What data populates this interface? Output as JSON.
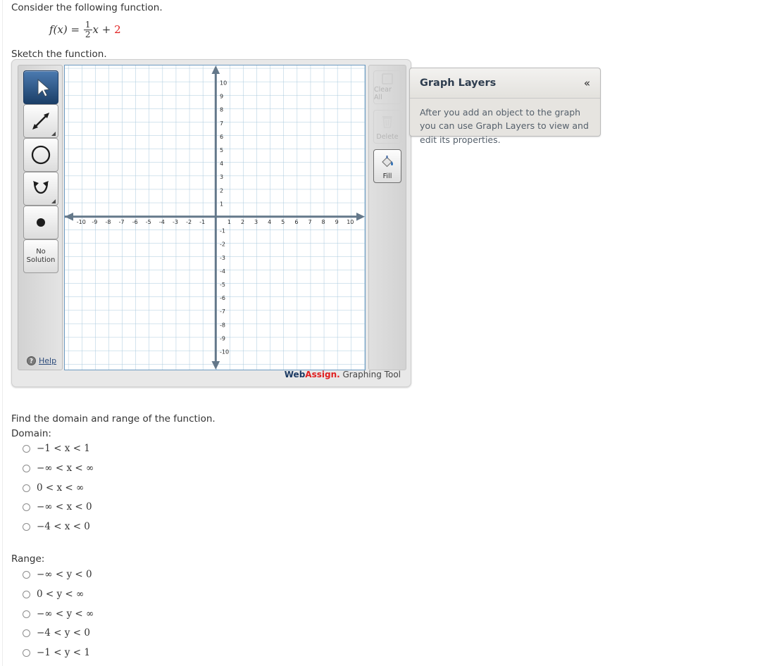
{
  "prompt": {
    "line1": "Consider the following function.",
    "formula": {
      "fname": "f(x)",
      "eq": "=",
      "num": "1",
      "den": "2",
      "var": "x",
      "plus": "+",
      "constant": "2"
    },
    "line2": "Sketch the function."
  },
  "graph_tool": {
    "left_toolbar": [
      {
        "name": "select-tool",
        "label": "Select",
        "selected": true
      },
      {
        "name": "line-tool",
        "label": "Line",
        "selected": false
      },
      {
        "name": "circle-tool",
        "label": "Circle",
        "selected": false
      },
      {
        "name": "parabola-tool",
        "label": "Parabola",
        "selected": false
      },
      {
        "name": "point-tool",
        "label": "Point",
        "selected": false
      },
      {
        "name": "no-solution-tool",
        "label_line1": "No",
        "label_line2": "Solution",
        "selected": false
      }
    ],
    "help_label": "Help",
    "right_toolbar": [
      {
        "name": "clear-all-button",
        "label": "Clear All",
        "enabled": false
      },
      {
        "name": "delete-button",
        "label": "Delete",
        "enabled": false
      },
      {
        "name": "fill-button",
        "label": "Fill",
        "enabled": true
      }
    ],
    "brand": {
      "web": "Web",
      "assign": "Assign.",
      "suffix": " Graphing Tool"
    },
    "axes": {
      "x_labels": [
        "-10",
        "-9",
        "-8",
        "-7",
        "-6",
        "-5",
        "-4",
        "-3",
        "-2",
        "-1",
        "1",
        "2",
        "3",
        "4",
        "5",
        "6",
        "7",
        "8",
        "9",
        "10"
      ],
      "y_labels": [
        "10",
        "9",
        "8",
        "7",
        "6",
        "5",
        "4",
        "3",
        "2",
        "1",
        "-1",
        "-2",
        "-3",
        "-4",
        "-5",
        "-6",
        "-7",
        "-8",
        "-9",
        "-10"
      ],
      "xmin": -11,
      "xmax": 11,
      "ymin": -11,
      "ymax": 11,
      "grid_color": "#9dc0d6",
      "axis_color": "#64788a"
    }
  },
  "graph_layers": {
    "title": "Graph Layers",
    "collapse_icon": "«",
    "body": "After you add an object to the graph you can use Graph Layers to view and edit its properties."
  },
  "questions": {
    "heading": "Find the domain and range of the function.",
    "domain_label": "Domain:",
    "domain_options": [
      "−1 < x < 1",
      "−∞ < x < ∞",
      "0 < x < ∞",
      "−∞ < x < 0",
      "−4 < x < 0"
    ],
    "range_label": "Range:",
    "range_options": [
      "−∞ < y < 0",
      "0 < y < ∞",
      "−∞ < y < ∞",
      "−4 < y < 0",
      "−1 < y < 1"
    ]
  }
}
